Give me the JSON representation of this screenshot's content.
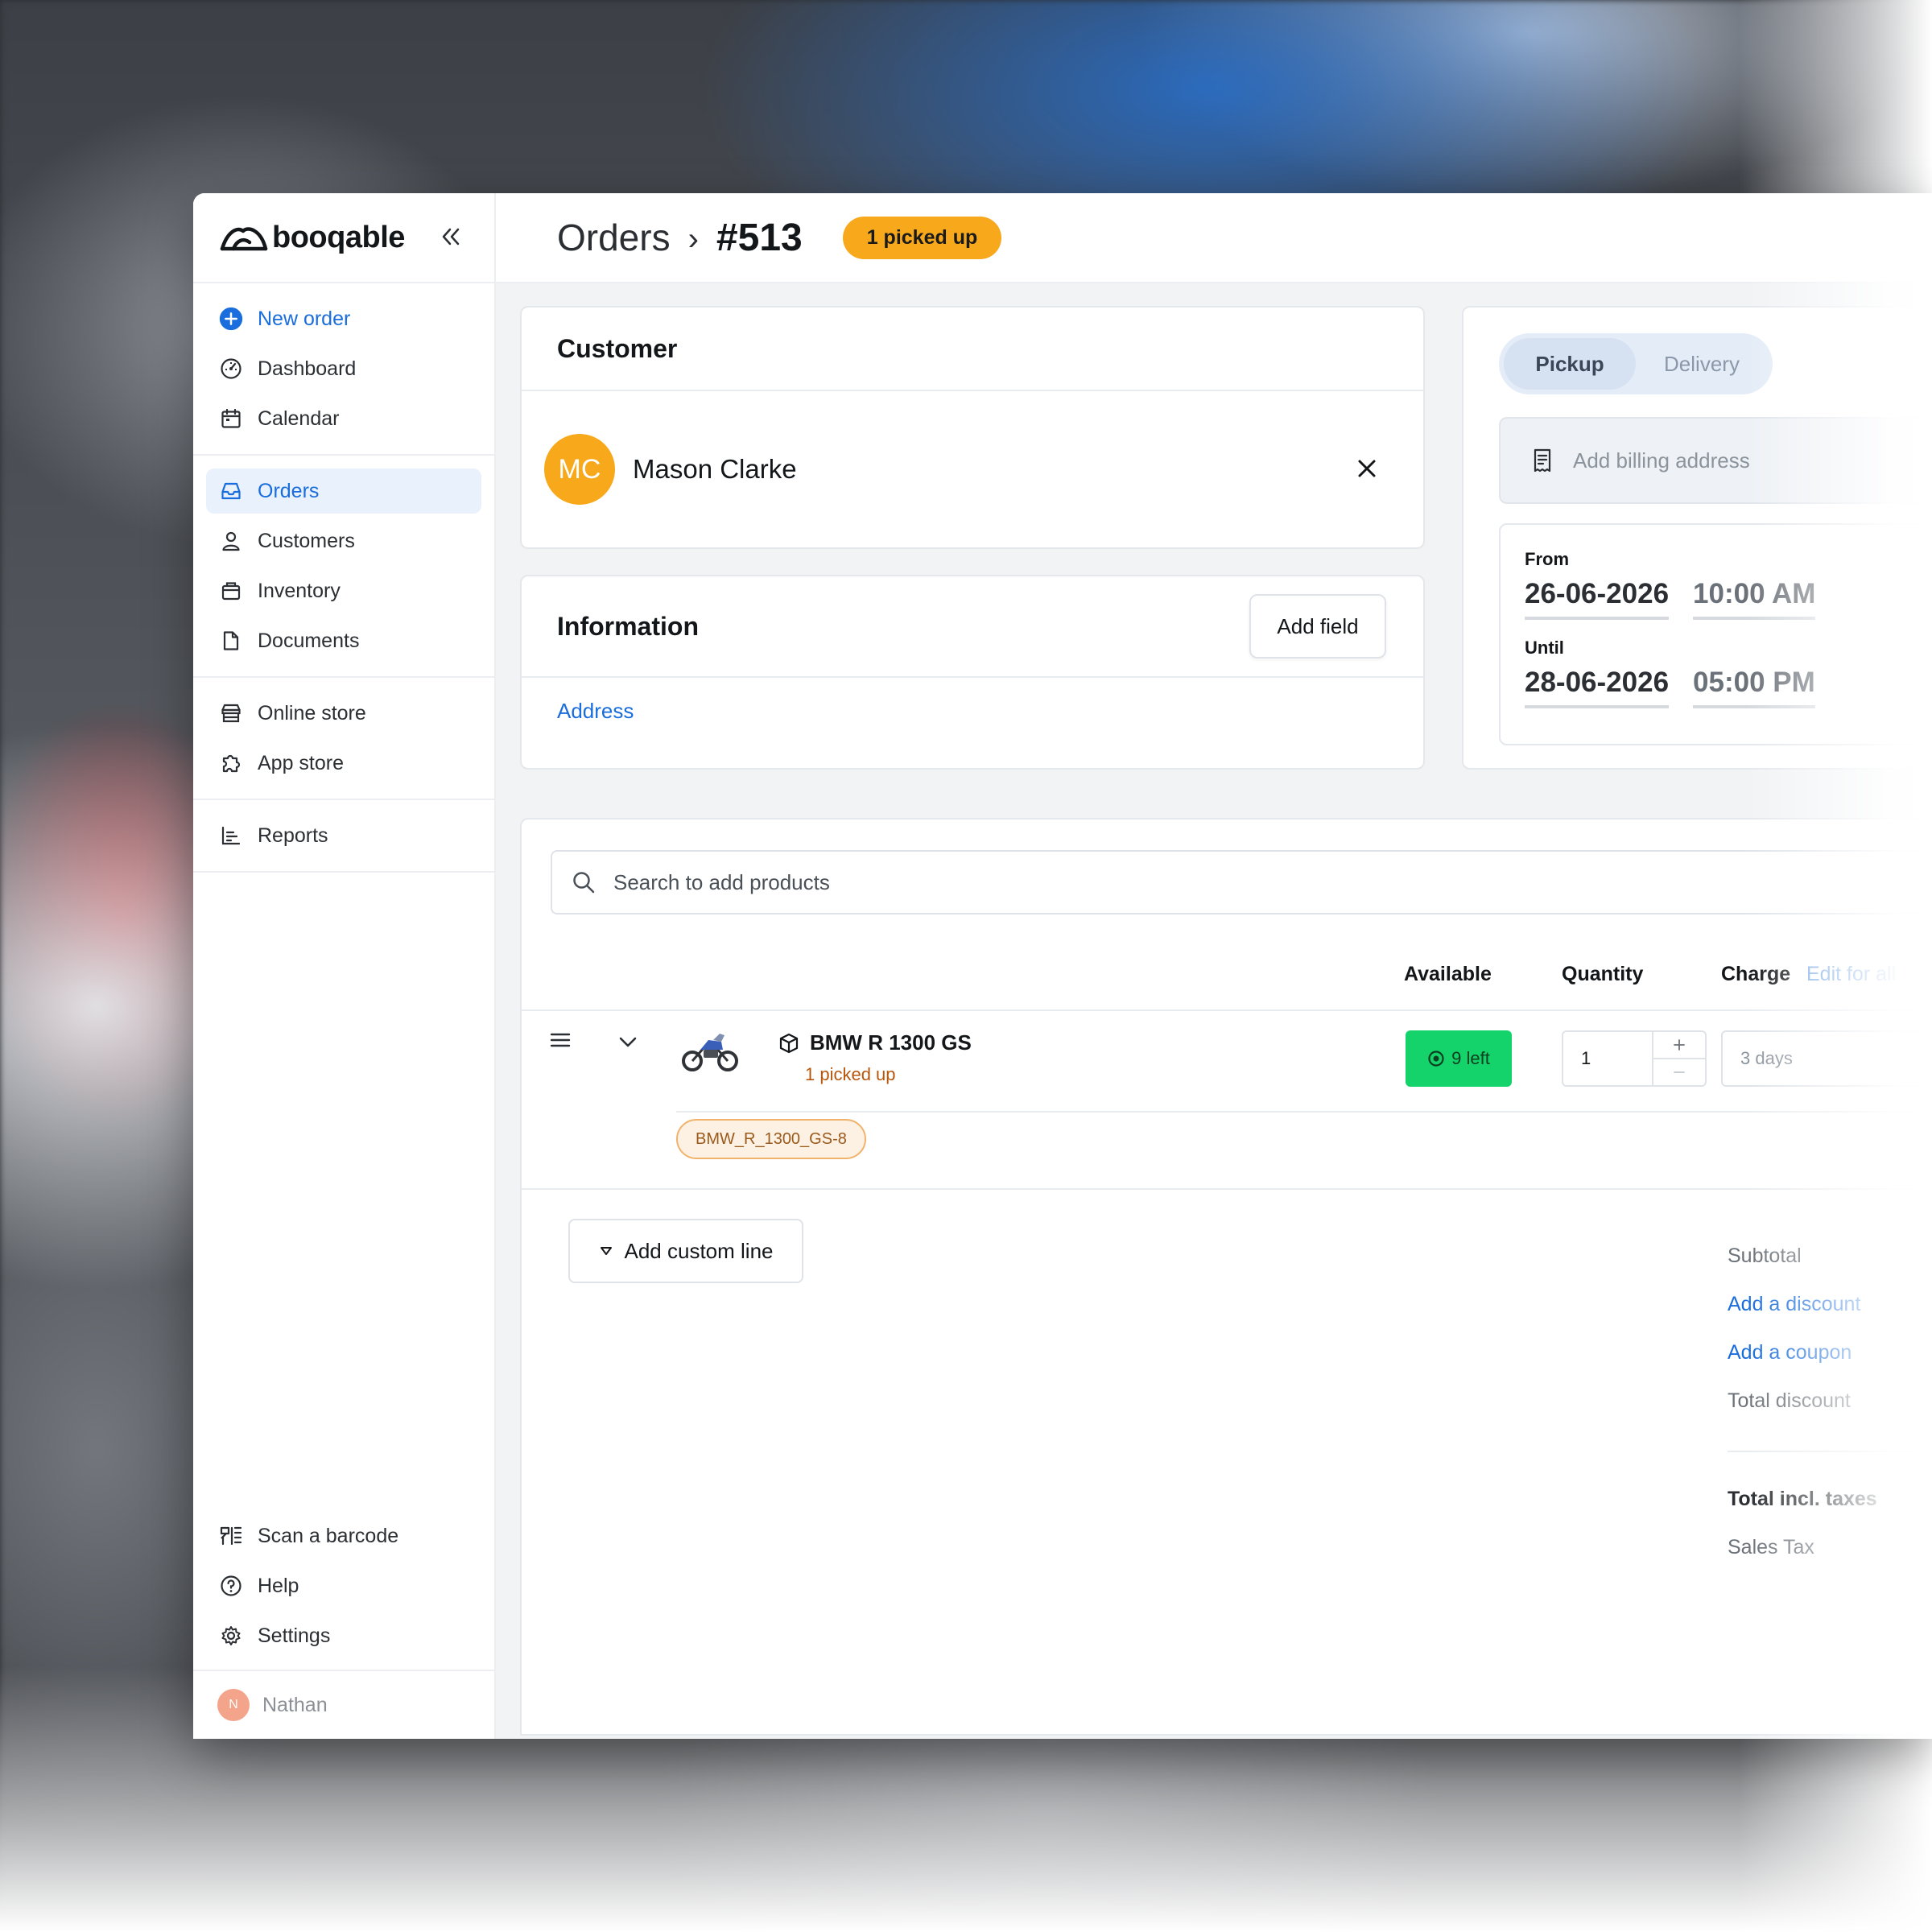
{
  "brand": {
    "name": "booqable"
  },
  "nav": {
    "primary": [
      {
        "label": "New order",
        "icon": "plus-circle-icon"
      },
      {
        "label": "Dashboard",
        "icon": "gauge-icon"
      },
      {
        "label": "Calendar",
        "icon": "calendar-icon"
      }
    ],
    "main": [
      {
        "label": "Orders",
        "icon": "inbox-icon",
        "active": true
      },
      {
        "label": "Customers",
        "icon": "user-icon"
      },
      {
        "label": "Inventory",
        "icon": "box-icon"
      },
      {
        "label": "Documents",
        "icon": "document-icon"
      }
    ],
    "store": [
      {
        "label": "Online store",
        "icon": "storefront-icon"
      },
      {
        "label": "App store",
        "icon": "puzzle-icon"
      }
    ],
    "reports": [
      {
        "label": "Reports",
        "icon": "chart-icon"
      }
    ],
    "bottom": [
      {
        "label": "Scan a barcode",
        "icon": "barcode-icon"
      },
      {
        "label": "Help",
        "icon": "help-icon"
      },
      {
        "label": "Settings",
        "icon": "gear-icon"
      }
    ],
    "user": {
      "initial": "N",
      "name": "Nathan"
    }
  },
  "header": {
    "breadcrumb": "Orders",
    "separator": "›",
    "order_number": "#513",
    "status": "1 picked up"
  },
  "customer": {
    "title": "Customer",
    "initials": "MC",
    "name": "Mason Clarke"
  },
  "information": {
    "title": "Information",
    "add_field": "Add field",
    "address_link": "Address"
  },
  "fulfillment": {
    "options": [
      "Pickup",
      "Delivery"
    ],
    "selected": "Pickup",
    "billing_placeholder": "Add billing address",
    "from_label": "From",
    "from_date": "26-06-2026",
    "from_time": "10:00 AM",
    "until_label": "Until",
    "until_date": "28-06-2026",
    "until_time": "05:00 PM"
  },
  "products": {
    "search_placeholder": "Search to add products",
    "columns": {
      "available": "Available",
      "quantity": "Quantity",
      "charge": "Charge",
      "edit_all": "Edit for all"
    },
    "lines": [
      {
        "name": "BMW R 1300 GS",
        "status": "1 picked up",
        "available": "9 left",
        "quantity": "1",
        "charge": "3 days",
        "stock_item": "BMW_R_1300_GS-8"
      }
    ],
    "add_custom_line": "Add custom line"
  },
  "totals": {
    "subtotal": "Subtotal",
    "add_discount": "Add a discount",
    "add_coupon": "Add a coupon",
    "total_discount": "Total discount",
    "total_incl_taxes": "Total incl. taxes",
    "sales_tax": "Sales Tax"
  },
  "colors": {
    "accent": "#1a6ddc",
    "status_orange": "#f7a81b",
    "available_green": "#14d36a"
  }
}
